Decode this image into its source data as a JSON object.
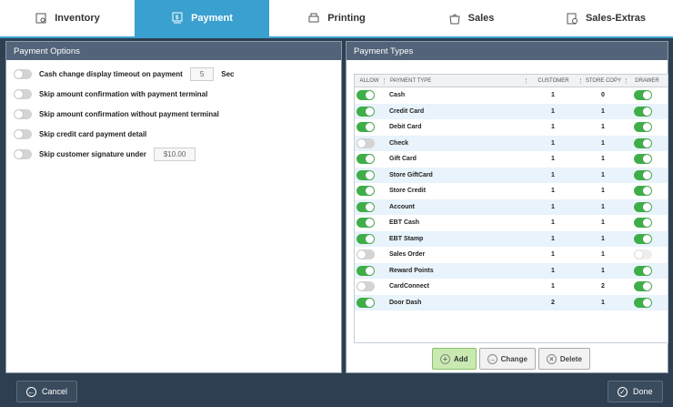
{
  "tabs": [
    {
      "label": "Inventory",
      "icon": "inventory-icon"
    },
    {
      "label": "Payment",
      "icon": "payment-icon",
      "active": true
    },
    {
      "label": "Printing",
      "icon": "printer-icon"
    },
    {
      "label": "Sales",
      "icon": "bag-icon"
    },
    {
      "label": "Sales-Extras",
      "icon": "sales-extras-icon"
    }
  ],
  "left": {
    "title": "Payment Options",
    "options": [
      {
        "label": "Cash change display timeout on payment",
        "value": "5",
        "suffix": "Sec"
      },
      {
        "label": "Skip amount confirmation with payment terminal"
      },
      {
        "label": "Skip amount confirmation without payment terminal"
      },
      {
        "label": "Skip credit card payment detail"
      },
      {
        "label": "Skip customer signature under",
        "value": "$10.00"
      }
    ]
  },
  "right": {
    "title": "Payment Types",
    "columns": {
      "allow": "ALLOW",
      "type": "PAYMENT TYPE",
      "customer": "CUSTOMER",
      "store": "STORE COPY",
      "drawer": "DRAWER"
    },
    "rows": [
      {
        "allow": true,
        "type": "Cash",
        "customer": "1",
        "store": "0",
        "drawer": true
      },
      {
        "allow": true,
        "type": "Credit Card",
        "customer": "1",
        "store": "1",
        "drawer": true
      },
      {
        "allow": true,
        "type": "Debit Card",
        "customer": "1",
        "store": "1",
        "drawer": true
      },
      {
        "allow": false,
        "type": "Check",
        "customer": "1",
        "store": "1",
        "drawer": true
      },
      {
        "allow": true,
        "type": "Gift Card",
        "customer": "1",
        "store": "1",
        "drawer": true
      },
      {
        "allow": true,
        "type": "Store GiftCard",
        "customer": "1",
        "store": "1",
        "drawer": true
      },
      {
        "allow": true,
        "type": "Store Credit",
        "customer": "1",
        "store": "1",
        "drawer": true
      },
      {
        "allow": true,
        "type": "Account",
        "customer": "1",
        "store": "1",
        "drawer": true
      },
      {
        "allow": true,
        "type": "EBT Cash",
        "customer": "1",
        "store": "1",
        "drawer": true
      },
      {
        "allow": true,
        "type": "EBT Stamp",
        "customer": "1",
        "store": "1",
        "drawer": true
      },
      {
        "allow": false,
        "type": "Sales Order",
        "customer": "1",
        "store": "1",
        "drawer": false
      },
      {
        "allow": true,
        "type": "Reward Points",
        "customer": "1",
        "store": "1",
        "drawer": true
      },
      {
        "allow": false,
        "type": "CardConnect",
        "customer": "1",
        "store": "2",
        "drawer": true
      },
      {
        "allow": true,
        "type": "Door Dash",
        "customer": "2",
        "store": "1",
        "drawer": true
      }
    ],
    "buttons": {
      "add": "Add",
      "change": "Change",
      "delete": "Delete"
    }
  },
  "footer": {
    "cancel": "Cancel",
    "done": "Done"
  },
  "colors": {
    "accent": "#3aa0cf",
    "toggle_on": "#3fae49",
    "header": "#53637a",
    "footer": "#2e3f52"
  }
}
